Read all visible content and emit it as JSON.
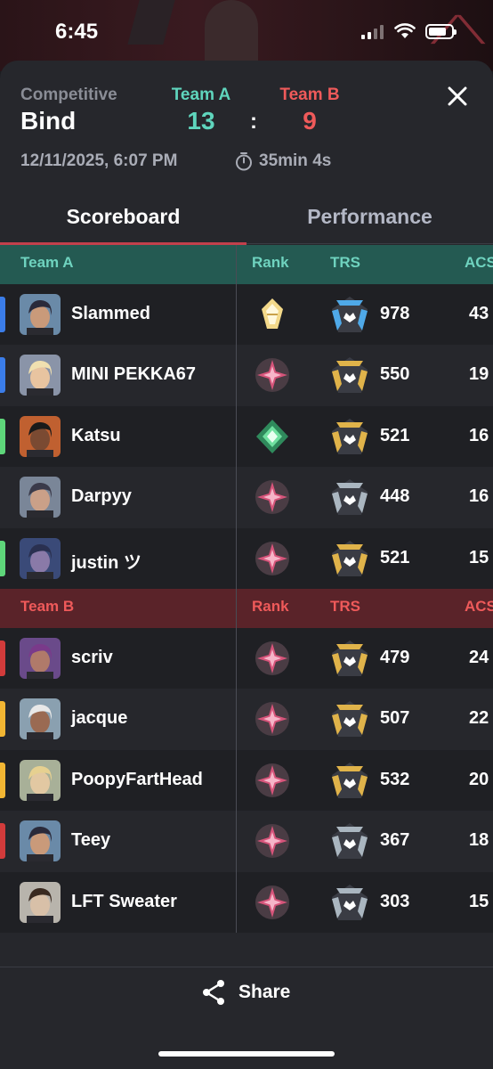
{
  "status": {
    "time": "6:45"
  },
  "match": {
    "mode": "Competitive",
    "map": "Bind",
    "team_a_label": "Team A",
    "team_a_score": "13",
    "team_b_label": "Team B",
    "team_b_score": "9",
    "separator": ":",
    "date": "12/11/2025, 6:07 PM",
    "duration": "35min 4s"
  },
  "tabs": [
    {
      "label": "Scoreboard",
      "active": true
    },
    {
      "label": "Performance",
      "active": false
    }
  ],
  "columns": {
    "rank": "Rank",
    "trs": "TRS",
    "acs": "ACS"
  },
  "team_a": {
    "name": "Team A",
    "color": "#6fd3bf",
    "players": [
      {
        "name": "Slammed",
        "trs": "978",
        "acs": "43",
        "marker": "#3b7de9",
        "rank_icon": "radiant-icon",
        "trs_icon": "trs-blue-icon"
      },
      {
        "name": "MINI PEKKA67",
        "trs": "550",
        "acs": "19",
        "marker": "#3b7de9",
        "rank_icon": "rank-pink-icon",
        "trs_icon": "trs-gold-icon"
      },
      {
        "name": "Katsu",
        "trs": "521",
        "acs": "16",
        "marker": "#5ed67a",
        "rank_icon": "ascendant-icon",
        "trs_icon": "trs-gold-icon"
      },
      {
        "name": "Darpyy",
        "trs": "448",
        "acs": "16",
        "marker": "",
        "rank_icon": "rank-pink-icon",
        "trs_icon": "trs-silver-icon"
      },
      {
        "name": "justin ツ",
        "trs": "521",
        "acs": "15",
        "marker": "#5ed67a",
        "rank_icon": "rank-pink-icon",
        "trs_icon": "trs-gold-icon"
      }
    ]
  },
  "team_b": {
    "name": "Team B",
    "color": "#ef5a5a",
    "players": [
      {
        "name": "scriv",
        "trs": "479",
        "acs": "24",
        "marker": "#d23b3b",
        "rank_icon": "rank-pink-icon",
        "trs_icon": "trs-gold-icon"
      },
      {
        "name": "jacque",
        "trs": "507",
        "acs": "22",
        "marker": "#f2b633",
        "rank_icon": "rank-pink-icon",
        "trs_icon": "trs-gold-icon"
      },
      {
        "name": "PoopyFartHead",
        "trs": "532",
        "acs": "20",
        "marker": "#f2b633",
        "rank_icon": "rank-pink-icon",
        "trs_icon": "trs-gold-icon"
      },
      {
        "name": "Teey",
        "trs": "367",
        "acs": "18",
        "marker": "#d23b3b",
        "rank_icon": "rank-pink-icon",
        "trs_icon": "trs-silver-icon"
      },
      {
        "name": "LFT Sweater",
        "trs": "303",
        "acs": "15",
        "marker": "",
        "rank_icon": "rank-pink-icon",
        "trs_icon": "trs-silver-icon"
      }
    ]
  },
  "share": {
    "label": "Share"
  }
}
